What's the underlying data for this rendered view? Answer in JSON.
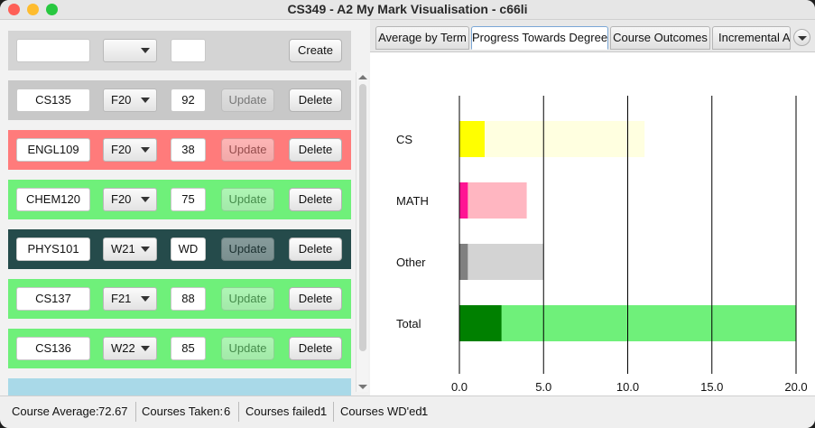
{
  "window": {
    "title": "CS349 - A2 My Mark Visualisation - c66li"
  },
  "create_row": {
    "code_value": "",
    "term_value": "",
    "grade_value": "",
    "create_label": "Create"
  },
  "courses": [
    {
      "code": "CS135",
      "term": "F20",
      "grade": "92",
      "update_label": "Update",
      "delete_label": "Delete",
      "color": "#c8c8c8"
    },
    {
      "code": "ENGL109",
      "term": "F20",
      "grade": "38",
      "update_label": "Update",
      "delete_label": "Delete",
      "color": "#ff7b7b"
    },
    {
      "code": "CHEM120",
      "term": "F20",
      "grade": "75",
      "update_label": "Update",
      "delete_label": "Delete",
      "color": "#6ff07a"
    },
    {
      "code": "PHYS101",
      "term": "W21",
      "grade": "WD",
      "update_label": "Update",
      "delete_label": "Delete",
      "color": "#254b4b"
    },
    {
      "code": "CS137",
      "term": "F21",
      "grade": "88",
      "update_label": "Update",
      "delete_label": "Delete",
      "color": "#6ff07a"
    },
    {
      "code": "CS136",
      "term": "W22",
      "grade": "85",
      "update_label": "Update",
      "delete_label": "Delete",
      "color": "#6ff07a"
    }
  ],
  "partial_row_color": "#a9d9e8",
  "status": {
    "average_label": "Course Average:",
    "average_value": "72.67",
    "taken_label": "Courses Taken:",
    "taken_value": "6",
    "failed_label": "Courses failed:",
    "failed_value": "1",
    "wd_label": "Courses WD'ed:",
    "wd_value": "1"
  },
  "tabs": [
    {
      "label": "Average by Term",
      "active": false
    },
    {
      "label": "Progress Towards Degree",
      "active": true
    },
    {
      "label": "Course Outcomes",
      "active": false
    },
    {
      "label": "Incremental Av",
      "active": false
    }
  ],
  "chart_data": {
    "type": "bar",
    "orientation": "horizontal",
    "stacked": true,
    "categories": [
      "CS",
      "MATH",
      "Other",
      "Total"
    ],
    "series": [
      {
        "values": [
          1.5,
          0.5,
          0.5,
          2.5
        ],
        "colors": [
          "#ffff00",
          "#ff1493",
          "#808080",
          "#008000"
        ]
      },
      {
        "values": [
          11,
          4,
          5,
          20
        ],
        "colors": [
          "#ffffe0",
          "#ffb6c1",
          "#d3d3d3",
          "#6ff07a"
        ]
      }
    ],
    "x_ticks": [
      "0.0",
      "5.0",
      "10.0",
      "15.0",
      "20.0"
    ],
    "xlim": [
      0,
      20
    ],
    "grid": "vertical"
  }
}
